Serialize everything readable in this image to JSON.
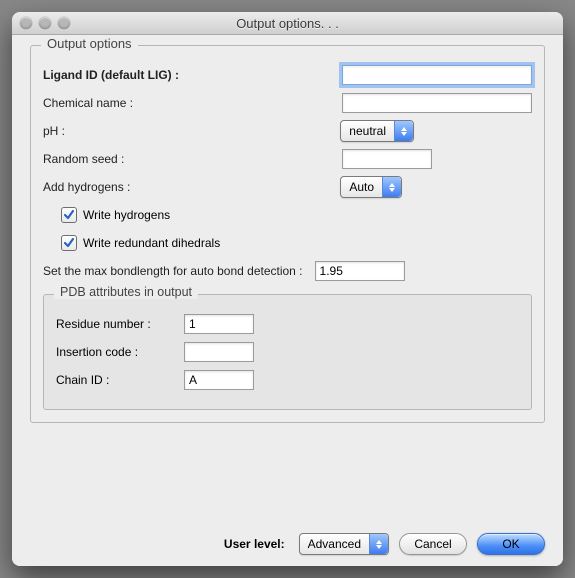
{
  "window": {
    "title": "Output options. . ."
  },
  "group": {
    "legend": "Output options"
  },
  "labels": {
    "ligand_id": "Ligand ID (default LIG) :",
    "chemical_name": "Chemical name :",
    "ph": "pH :",
    "random_seed": "Random seed :",
    "add_hydrogens": "Add hydrogens :",
    "write_hydrogens": "Write hydrogens",
    "write_redundant": "Write redundant dihedrals",
    "max_bondlength": "Set the max bondlength for auto bond detection :"
  },
  "values": {
    "ligand_id": "",
    "chemical_name": "",
    "ph_selected": "neutral",
    "random_seed": "",
    "add_hydrogens_selected": "Auto",
    "write_hydrogens_checked": true,
    "write_redundant_checked": true,
    "max_bondlength": "1.95"
  },
  "inner": {
    "legend": "PDB attributes in output",
    "labels": {
      "residue_number": "Residue number :",
      "insertion_code": "Insertion code :",
      "chain_id": "Chain ID :"
    },
    "values": {
      "residue_number": "1",
      "insertion_code": "",
      "chain_id": "A"
    }
  },
  "footer": {
    "user_level_label": "User level:",
    "user_level_value": "Advanced",
    "cancel": "Cancel",
    "ok": "OK"
  }
}
